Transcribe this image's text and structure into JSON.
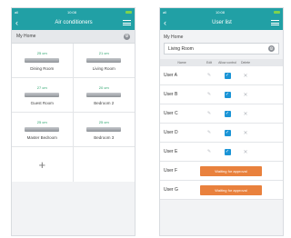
{
  "screen1": {
    "status": {
      "left": "all",
      "time": "10:08"
    },
    "title": "Air conditioners",
    "section": "My Home",
    "rooms": [
      {
        "temp": "25 cm",
        "name": "Dining Room"
      },
      {
        "temp": "21 cm",
        "name": "Living Room"
      },
      {
        "temp": "27 cm",
        "name": "Guest Room"
      },
      {
        "temp": "20 cm",
        "name": "Bedroom 2"
      },
      {
        "temp": "25 cm",
        "name": "Master Bedroom"
      },
      {
        "temp": "25 cm",
        "name": "Bedroom 3"
      }
    ],
    "add_glyph": "+"
  },
  "screen2": {
    "status": {
      "left": "all",
      "time": "10:08"
    },
    "title": "User list",
    "section": "My Home",
    "room_select": "Living Room",
    "columns": {
      "name": "Name",
      "edit": "Edit",
      "allow": "Allow control",
      "delete": "Delete"
    },
    "users": [
      {
        "name": "User A"
      },
      {
        "name": "User B"
      },
      {
        "name": "User C"
      },
      {
        "name": "User D"
      },
      {
        "name": "User E"
      }
    ],
    "pending_users": [
      {
        "name": "User F",
        "status": "Waiting for approval"
      },
      {
        "name": "User G",
        "status": "Waiting for approval"
      }
    ]
  },
  "icons": {
    "back": "‹",
    "gear": "⚙",
    "pencil": "✎",
    "check": "✓",
    "close": "✕",
    "dropdown": "⌄"
  },
  "colors": {
    "teal": "#21a0a5",
    "orange": "#e9813d",
    "blue": "#1a94d6",
    "green": "#2aa36b"
  }
}
